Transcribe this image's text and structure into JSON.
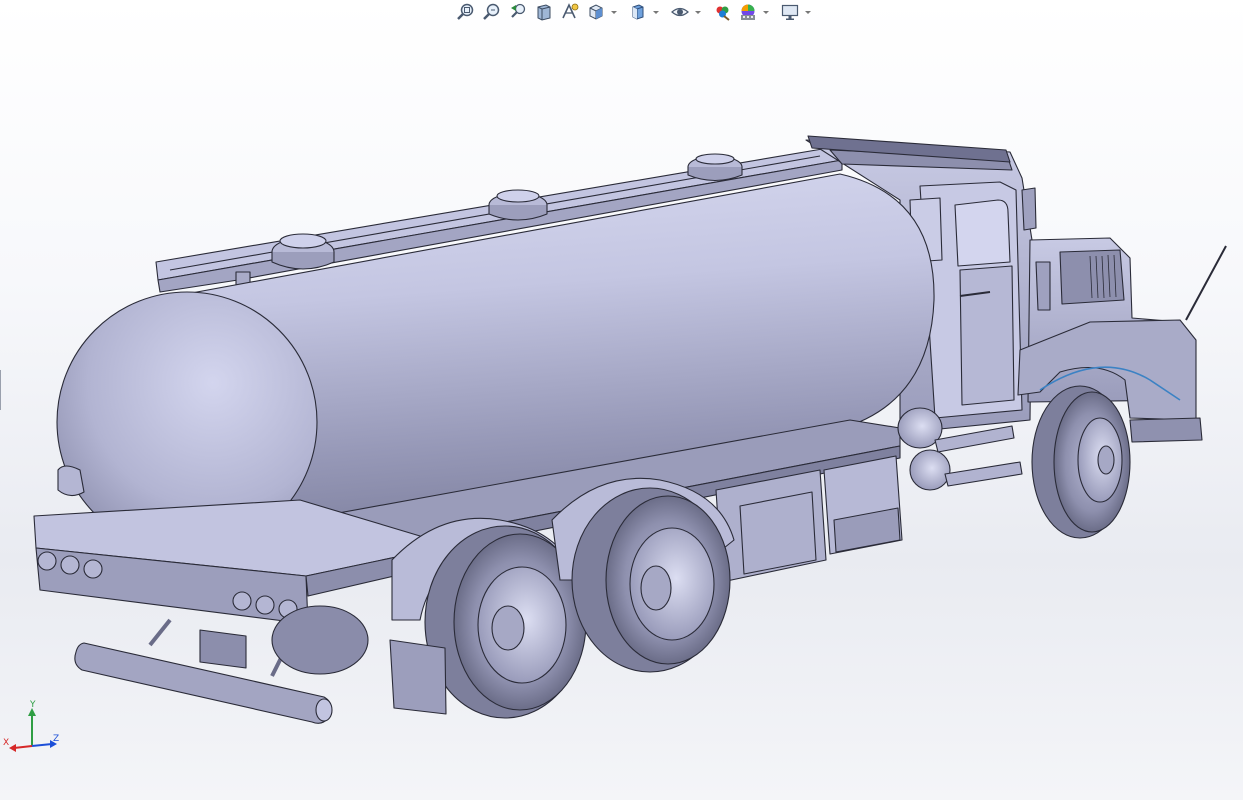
{
  "toolbar": {
    "items": [
      {
        "icon": "zoom-to-fit-icon"
      },
      {
        "icon": "zoom-to-area-icon"
      },
      {
        "icon": "previous-view-icon"
      },
      {
        "icon": "section-view-icon"
      },
      {
        "icon": "dynamic-annotation-icon"
      },
      {
        "icon": "view-orientation-icon",
        "dropdown": true
      },
      {
        "icon": "display-style-icon",
        "dropdown": true
      },
      {
        "icon": "hide-show-items-icon",
        "dropdown": true
      },
      {
        "icon": "edit-appearance-icon"
      },
      {
        "icon": "apply-scene-icon",
        "dropdown": true
      },
      {
        "icon": "view-settings-icon",
        "dropdown": true
      }
    ]
  },
  "triad": {
    "x_label": "X",
    "y_label": "Y",
    "z_label": "Z",
    "x_color": "#d62828",
    "y_color": "#2f9e44",
    "z_color": "#1c4fd8"
  },
  "model": {
    "name": "tanker-truck",
    "shade_color": "#c9cbe3",
    "edge_color": "#2a2b38"
  }
}
